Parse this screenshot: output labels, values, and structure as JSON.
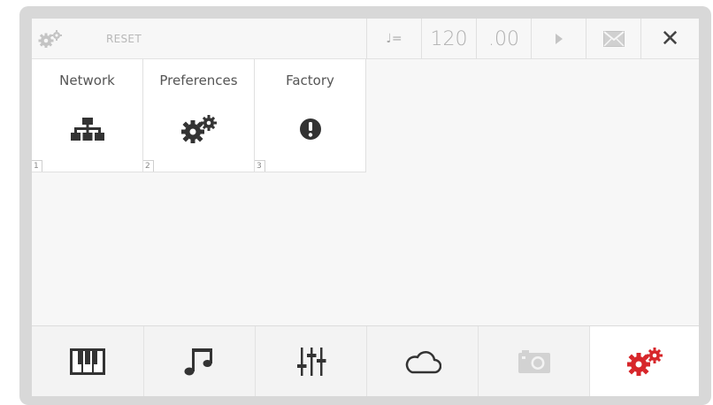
{
  "topbar": {
    "reset_label": "RESET",
    "tempo_symbol": "♩=",
    "bpm": "120",
    "bpm_fraction": ".00",
    "close_symbol": "✕"
  },
  "tiles": [
    {
      "label": "Network",
      "number": "1",
      "icon": "network-icon"
    },
    {
      "label": "Preferences",
      "number": "2",
      "icon": "gears-icon"
    },
    {
      "label": "Factory",
      "number": "3",
      "icon": "exclamation-icon"
    }
  ],
  "bottom_nav": [
    {
      "icon": "piano-keys-icon"
    },
    {
      "icon": "music-notes-icon"
    },
    {
      "icon": "mixer-sliders-icon"
    },
    {
      "icon": "cloud-icon"
    },
    {
      "icon": "camera-icon",
      "disabled": true
    },
    {
      "icon": "settings-gears-icon",
      "active": true
    }
  ],
  "colors": {
    "accent": "#d7262a",
    "icon_dark": "#333333",
    "icon_muted": "#c0c0c0",
    "text": "#555555"
  }
}
